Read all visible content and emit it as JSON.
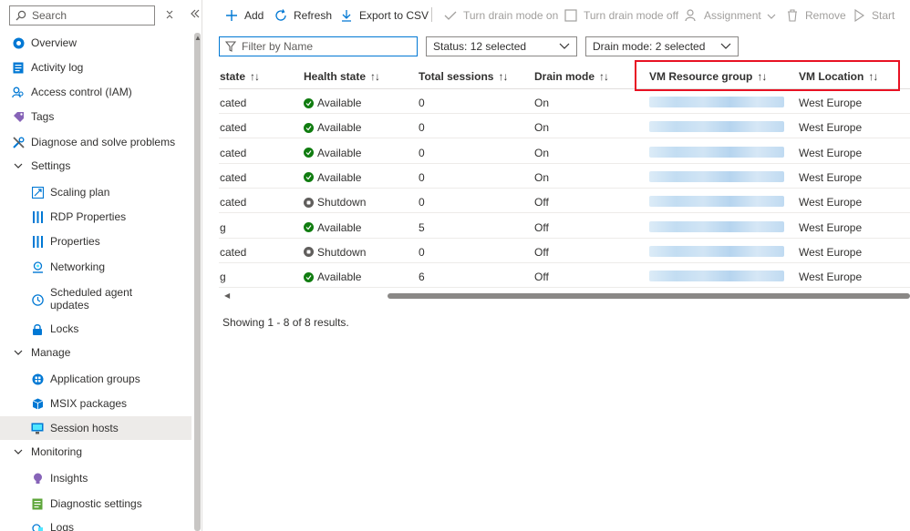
{
  "sidebar": {
    "search_placeholder": "Search",
    "items": [
      {
        "label": "Overview"
      },
      {
        "label": "Activity log"
      },
      {
        "label": "Access control (IAM)"
      },
      {
        "label": "Tags"
      },
      {
        "label": "Diagnose and solve problems"
      },
      {
        "label": "Settings"
      },
      {
        "label": "Scaling plan"
      },
      {
        "label": "RDP Properties"
      },
      {
        "label": "Properties"
      },
      {
        "label": "Networking"
      },
      {
        "label": "Scheduled agent"
      },
      {
        "label": "updates"
      },
      {
        "label": "Locks"
      },
      {
        "label": "Manage"
      },
      {
        "label": "Application groups"
      },
      {
        "label": "MSIX packages"
      },
      {
        "label": "Session hosts"
      },
      {
        "label": "Monitoring"
      },
      {
        "label": "Insights"
      },
      {
        "label": "Diagnostic settings"
      },
      {
        "label": "Logs"
      }
    ]
  },
  "toolbar": {
    "add": "Add",
    "refresh": "Refresh",
    "export": "Export to CSV",
    "drain_on": "Turn drain mode on",
    "drain_off": "Turn drain mode off",
    "assignment": "Assignment",
    "remove": "Remove",
    "start": "Start"
  },
  "filters": {
    "name_placeholder": "Filter by Name",
    "status": "Status: 12 selected",
    "drain": "Drain mode: 2 selected"
  },
  "table": {
    "headers": {
      "state": "state",
      "health": "Health state",
      "sessions": "Total sessions",
      "drain": "Drain mode",
      "rg": "VM Resource group",
      "location": "VM Location"
    },
    "sort_glyph": "↑↓",
    "rows": [
      {
        "state": "cated",
        "health": "Available",
        "health_status": "ok",
        "sessions": "0",
        "drain": "On",
        "location": "West Europe"
      },
      {
        "state": "cated",
        "health": "Available",
        "health_status": "ok",
        "sessions": "0",
        "drain": "On",
        "location": "West Europe"
      },
      {
        "state": "cated",
        "health": "Available",
        "health_status": "ok",
        "sessions": "0",
        "drain": "On",
        "location": "West Europe"
      },
      {
        "state": "cated",
        "health": "Available",
        "health_status": "ok",
        "sessions": "0",
        "drain": "On",
        "location": "West Europe"
      },
      {
        "state": "cated",
        "health": "Shutdown",
        "health_status": "shutdown",
        "sessions": "0",
        "drain": "Off",
        "location": "West Europe"
      },
      {
        "state": "g",
        "health": "Available",
        "health_status": "ok",
        "sessions": "5",
        "drain": "Off",
        "location": "West Europe"
      },
      {
        "state": "cated",
        "health": "Shutdown",
        "health_status": "shutdown",
        "sessions": "0",
        "drain": "Off",
        "location": "West Europe"
      },
      {
        "state": "g",
        "health": "Available",
        "health_status": "ok",
        "sessions": "6",
        "drain": "Off",
        "location": "West Europe"
      }
    ]
  },
  "results": "Showing 1 - 8 of 8 results.",
  "colors": {
    "accent": "#0078d4",
    "ok": "#107c10",
    "shutdown": "#605e5c",
    "highlight": "#e81123"
  }
}
